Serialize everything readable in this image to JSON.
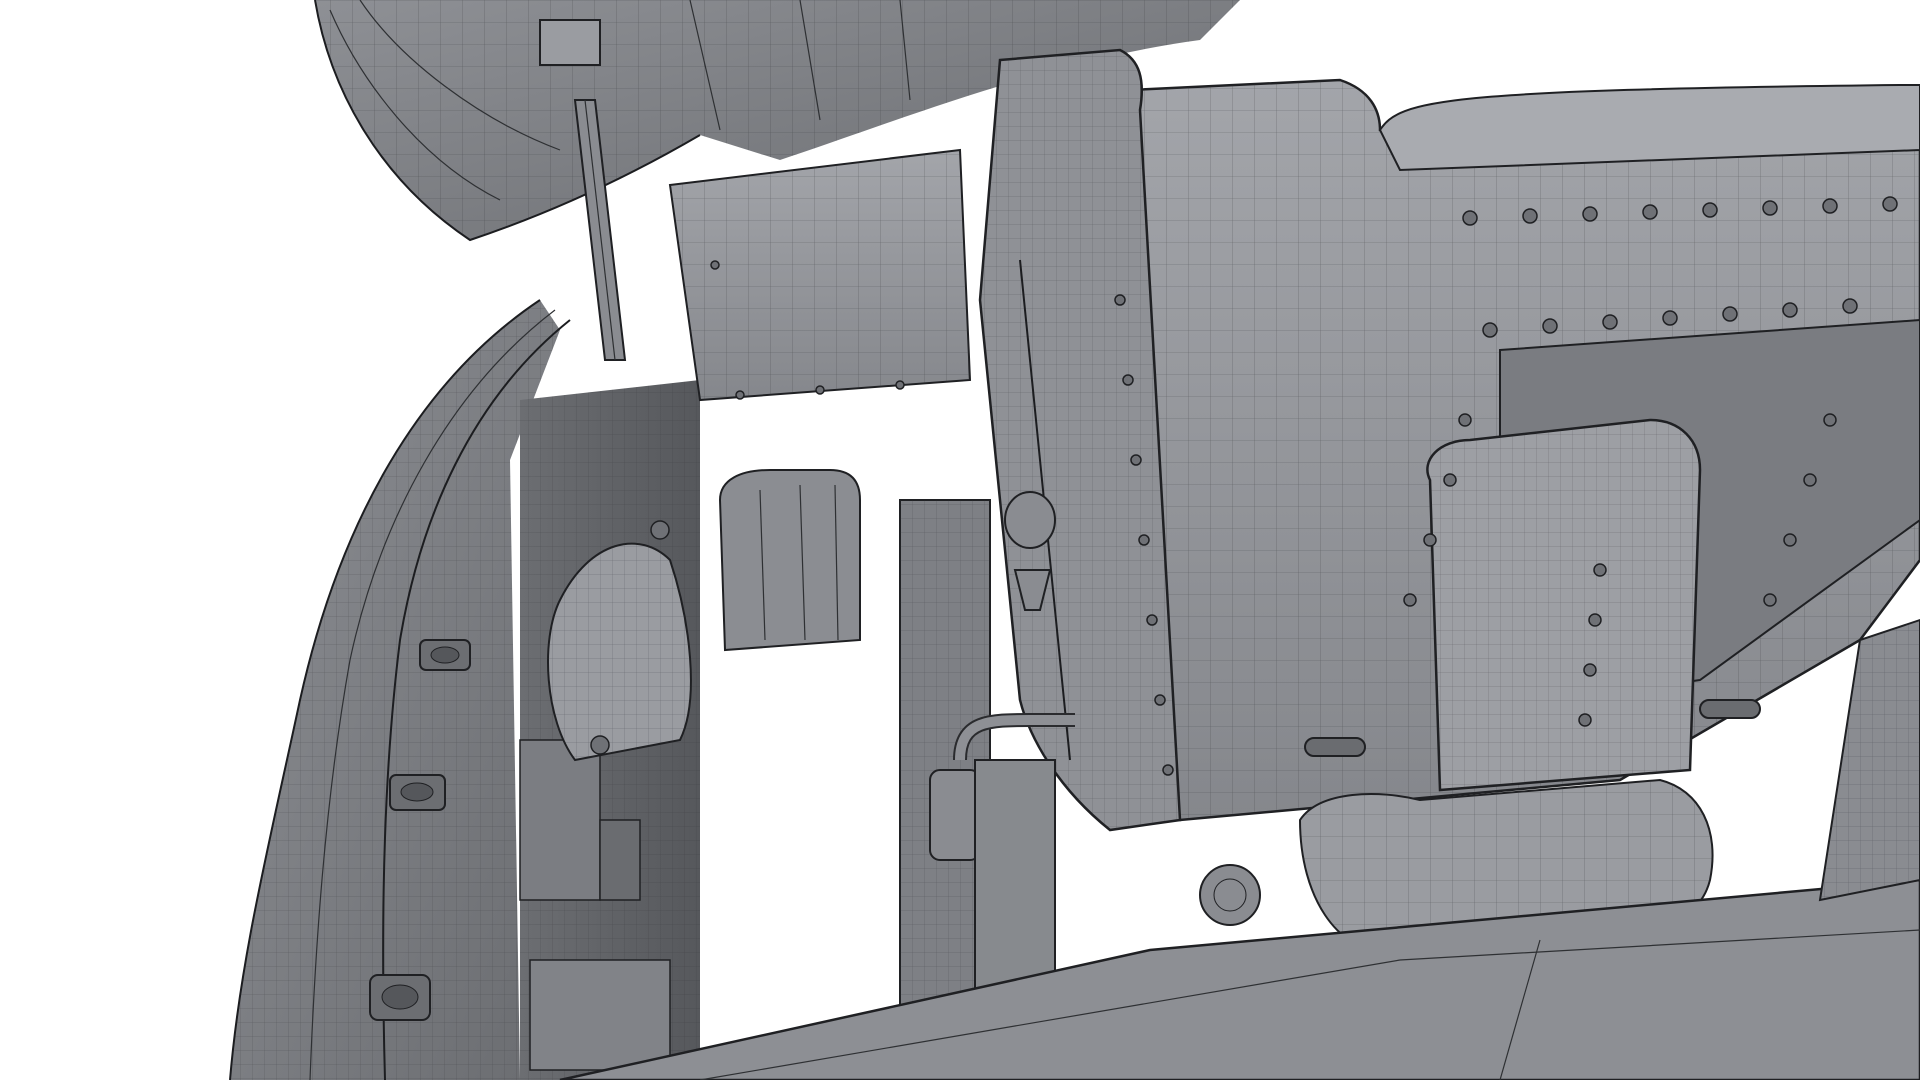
{
  "viewport": {
    "background": "#ffffff",
    "model_fill": "#7c7e83",
    "model_light": "#9a9ca1",
    "model_dark": "#5d5f63",
    "wire_color": "#2e3033"
  }
}
